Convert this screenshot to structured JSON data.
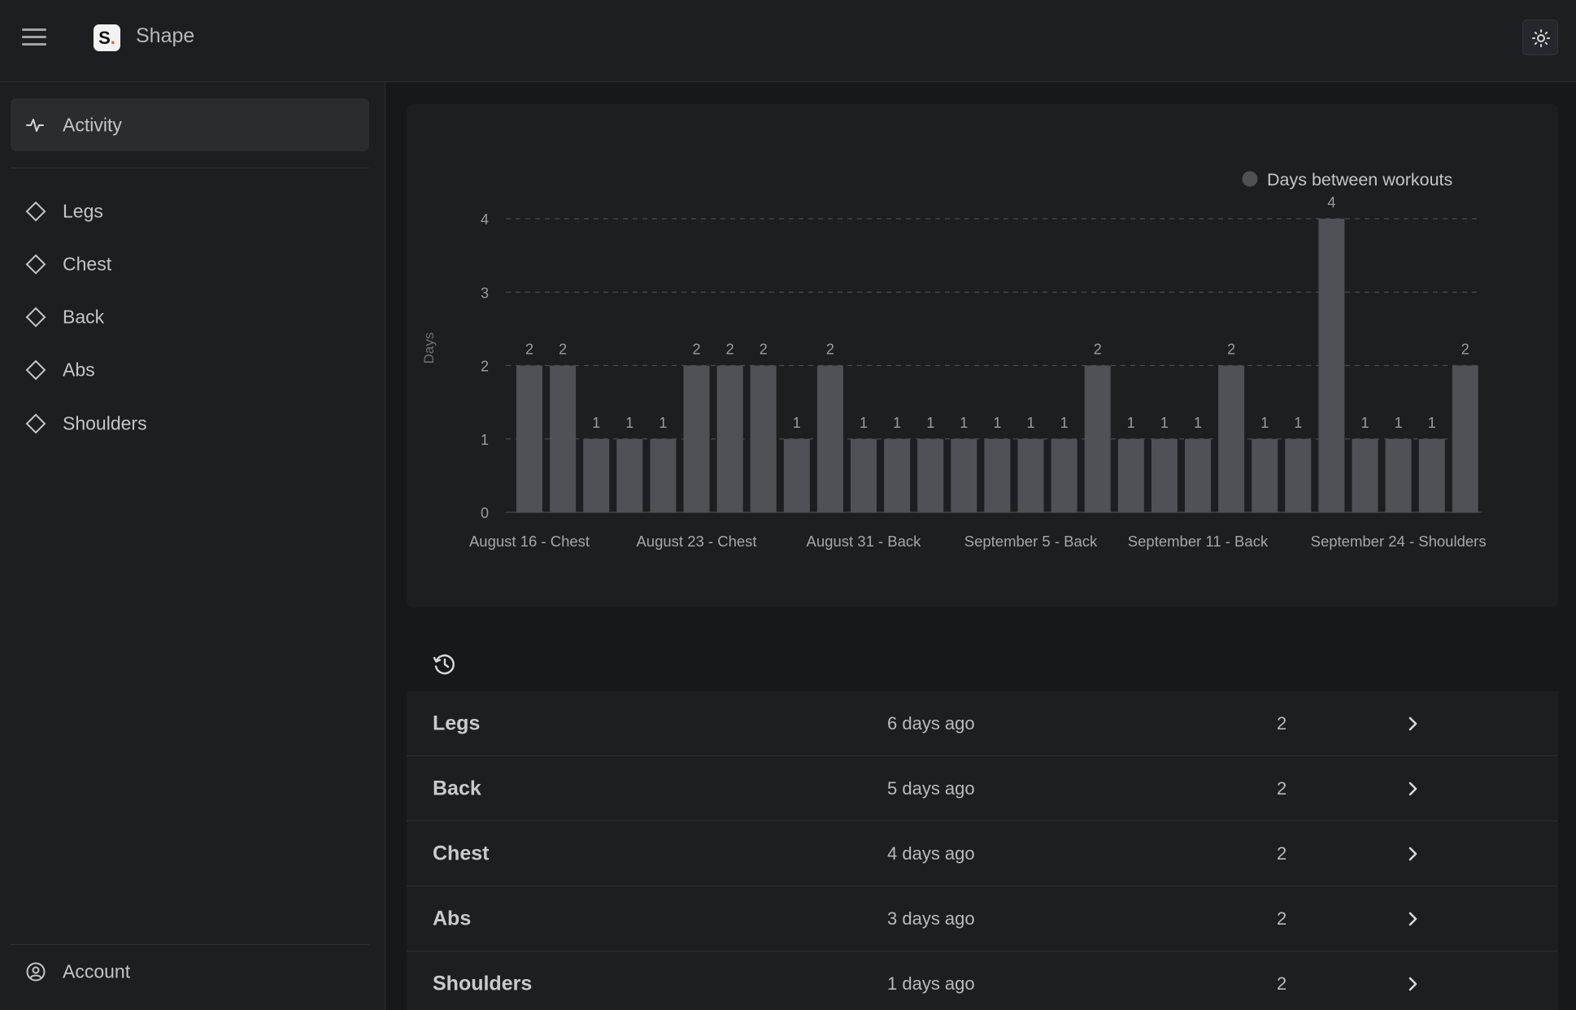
{
  "app": {
    "title": "Shape",
    "logo_text": "S",
    "logo_dot": "."
  },
  "header": {
    "menu_icon": "hamburger-menu-icon",
    "theme_icon": "sun-icon"
  },
  "sidebar": {
    "active": {
      "label": "Activity",
      "icon": "activity-pulse-icon"
    },
    "items": [
      {
        "label": "Legs",
        "icon": "diamond-icon"
      },
      {
        "label": "Chest",
        "icon": "diamond-icon"
      },
      {
        "label": "Back",
        "icon": "diamond-icon"
      },
      {
        "label": "Abs",
        "icon": "diamond-icon"
      },
      {
        "label": "Shoulders",
        "icon": "diamond-icon"
      }
    ],
    "account": {
      "label": "Account",
      "icon": "user-circle-icon"
    }
  },
  "chart_data": {
    "type": "bar",
    "ylabel": "Days",
    "xlabel": "",
    "ylim": [
      0,
      4
    ],
    "y_ticks": [
      0,
      1,
      2,
      3,
      4
    ],
    "grid": true,
    "legend_position": "top-right",
    "series": [
      {
        "name": "Days between workouts",
        "color": "#4f5157",
        "values": [
          2,
          2,
          1,
          1,
          1,
          2,
          2,
          2,
          1,
          2,
          1,
          1,
          1,
          1,
          1,
          1,
          1,
          2,
          1,
          1,
          1,
          2,
          1,
          1,
          4,
          1,
          1,
          1,
          2
        ]
      }
    ],
    "x_tick_labels": [
      {
        "index": 0,
        "label": "August 16 - Chest"
      },
      {
        "index": 5,
        "label": "August 23 - Chest"
      },
      {
        "index": 10,
        "label": "August 31 - Back"
      },
      {
        "index": 15,
        "label": "September 5 - Back"
      },
      {
        "index": 20,
        "label": "September 11 - Back"
      },
      {
        "index": 26,
        "label": "September 24 - Shoulders"
      }
    ]
  },
  "history": {
    "icon": "history-clock-icon",
    "rows": [
      {
        "name": "Legs",
        "time": "6 days ago",
        "count": "2"
      },
      {
        "name": "Back",
        "time": "5 days ago",
        "count": "2"
      },
      {
        "name": "Chest",
        "time": "4 days ago",
        "count": "2"
      },
      {
        "name": "Abs",
        "time": "3 days ago",
        "count": "2"
      },
      {
        "name": "Shoulders",
        "time": "1 days ago",
        "count": "2"
      }
    ],
    "row_action_icon": "chevron-right-icon"
  }
}
